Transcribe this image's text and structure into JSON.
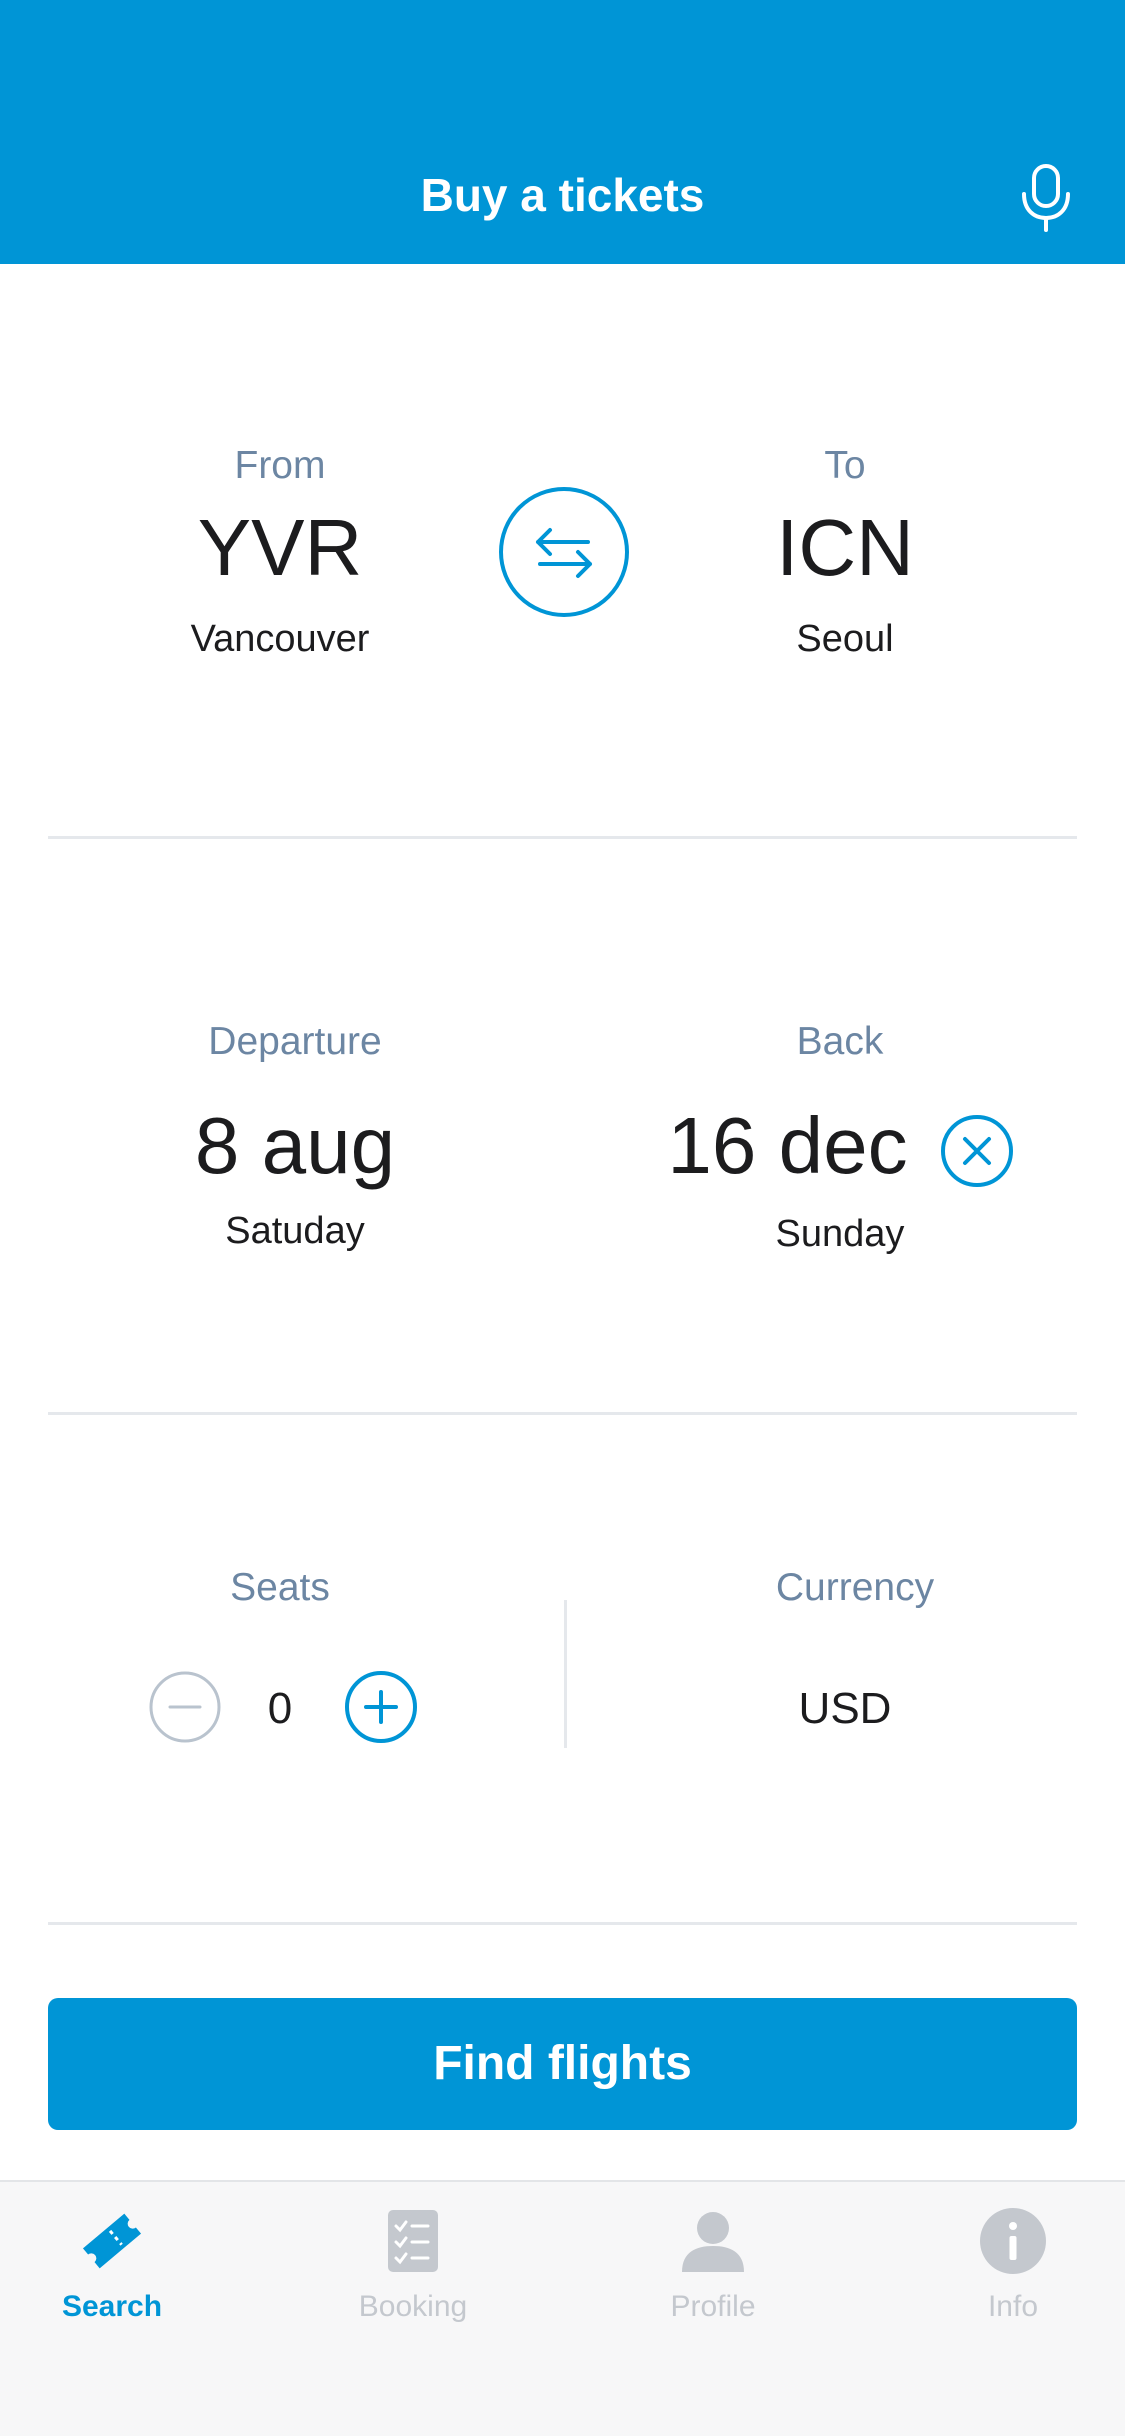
{
  "header": {
    "title": "Buy a tickets",
    "mic_icon": "microphone-icon"
  },
  "route": {
    "from": {
      "label": "From",
      "code": "YVR",
      "city": "Vancouver"
    },
    "to": {
      "label": "To",
      "code": "ICN",
      "city": "Seoul"
    },
    "swap_icon": "swap-arrows-icon"
  },
  "dates": {
    "departure": {
      "label": "Departure",
      "date": "8 aug",
      "weekday": "Satuday"
    },
    "back": {
      "label": "Back",
      "date": "16 dec",
      "weekday": "Sunday"
    },
    "clear_icon": "clear-x-circle-icon"
  },
  "seats": {
    "label": "Seats",
    "value": "0",
    "minus_icon": "minus-circle-icon",
    "plus_icon": "plus-circle-icon"
  },
  "currency": {
    "label": "Currency",
    "value": "USD"
  },
  "find_button": {
    "label": "Find flights"
  },
  "tabs": [
    {
      "label": "Search",
      "icon": "ticket-icon",
      "active": true
    },
    {
      "label": "Booking",
      "icon": "checklist-icon",
      "active": false
    },
    {
      "label": "Profile",
      "icon": "person-icon",
      "active": false
    },
    {
      "label": "Info",
      "icon": "info-icon",
      "active": false
    }
  ],
  "colors": {
    "accent": "#0095d6",
    "label": "#6c86a3",
    "inactive": "#c4c8ce",
    "divider": "#e5e8ec"
  }
}
